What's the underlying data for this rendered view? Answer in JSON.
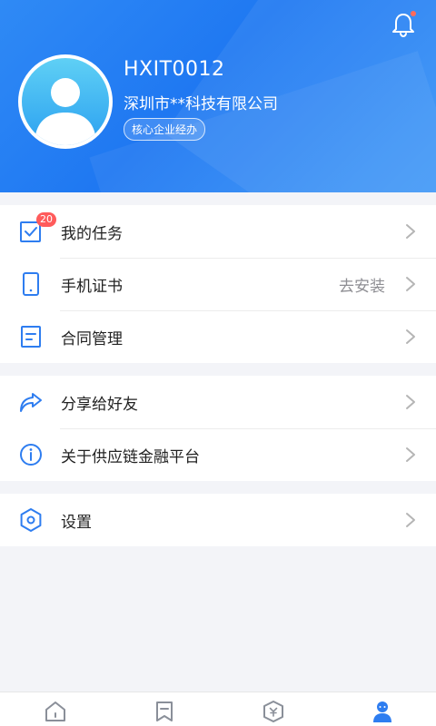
{
  "profile": {
    "user_id": "HXIT0012",
    "company": "深圳市**科技有限公司",
    "role": "核心企业经办"
  },
  "menu_group_1": [
    {
      "label": "我的任务",
      "badge": "20",
      "icon": "task-check-icon"
    },
    {
      "label": "手机证书",
      "value": "去安装",
      "icon": "phone-icon"
    },
    {
      "label": "合同管理",
      "icon": "document-icon"
    }
  ],
  "menu_group_2": [
    {
      "label": "分享给好友",
      "icon": "share-icon"
    },
    {
      "label": "关于供应链金融平台",
      "icon": "info-icon"
    }
  ],
  "menu_group_3": [
    {
      "label": "设置",
      "icon": "settings-icon"
    }
  ],
  "colors": {
    "header_blue": "#2f8af5",
    "accent_blue": "#2e7df0",
    "badge_red": "#ff5b5b",
    "notification_dot": "#ff6a5a"
  },
  "tabbar": {
    "tabs": [
      {
        "icon": "home-icon",
        "active": false
      },
      {
        "icon": "bookmark-icon",
        "active": false
      },
      {
        "icon": "finance-shield-icon",
        "active": false
      },
      {
        "icon": "person-icon",
        "active": true
      }
    ]
  }
}
